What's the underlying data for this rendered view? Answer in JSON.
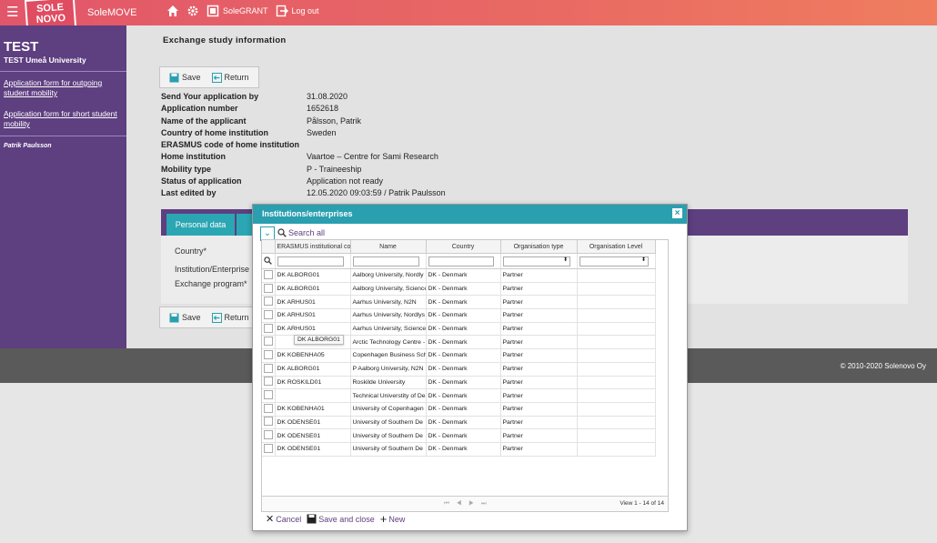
{
  "topbar": {
    "logo_top": "SOLE",
    "logo_bottom": "NOVO",
    "app_name": "SoleMOVE",
    "solegrant_label": "SoleGRANT",
    "logout_label": "Log out",
    "accent": "#e2566a"
  },
  "sidebar": {
    "title": "TEST",
    "org": "TEST Umeå University",
    "links": [
      "Application form for outgoing student mobility",
      "Application form for short student mobility"
    ],
    "user": "Patrik Paulsson"
  },
  "main": {
    "page_title": "Exchange study information",
    "save_label": "Save",
    "return_label": "Return",
    "info": [
      {
        "label": "Send Your application by",
        "value": "31.08.2020"
      },
      {
        "label": "Application number",
        "value": "1652618"
      },
      {
        "label": "Name of the applicant",
        "value": "Pålsson, Patrik"
      },
      {
        "label": "Country of home institution",
        "value": "Sweden"
      },
      {
        "label": "ERASMUS code of home institution",
        "value": ""
      },
      {
        "label": "Home institution",
        "value": "Vaartoe – Centre for Sami Research"
      },
      {
        "label": "Mobility type",
        "value": "P - Traineeship"
      },
      {
        "label": "Status of application",
        "value": "Application not ready"
      },
      {
        "label": "Last edited by",
        "value": "12.05.2020 09:03:59 / Patrik Paulsson"
      }
    ],
    "tab_personal": "Personal data",
    "form_labels": [
      "Country*",
      "Institution/Enterprise",
      "Exchange program*"
    ]
  },
  "footer": {
    "copyright": "© 2010-2020   Solenovo Oy"
  },
  "dialog": {
    "title": "Institutions/enterprises",
    "close": "×",
    "search_all": "Search all",
    "columns": [
      "ERASMUS institutional co",
      "Name",
      "Country",
      "Organisation type",
      "Organisation Level"
    ],
    "rows": [
      [
        "DK ALBORG01",
        "Aalborg University, Nordly",
        "DK - Denmark",
        "Partner",
        ""
      ],
      [
        "DK ALBORG01",
        "Aalborg University, Science",
        "DK - Denmark",
        "Partner",
        ""
      ],
      [
        "DK ARHUS01",
        "Aarhus University, N2N",
        "DK - Denmark",
        "Partner",
        ""
      ],
      [
        "DK ARHUS01",
        "Aarhus University, Nordlys",
        "DK - Denmark",
        "Partner",
        ""
      ],
      [
        "DK ARHUS01",
        "Aarhus University, Science",
        "DK - Denmark",
        "Partner",
        ""
      ],
      [
        "",
        "Arctic Technology Centre -",
        "DK - Denmark",
        "Partner",
        ""
      ],
      [
        "DK KOBENHA05",
        "Copenhagen Business Scho",
        "DK - Denmark",
        "Partner",
        ""
      ],
      [
        "DK ALBORG01",
        "P Aalborg University, N2N",
        "DK - Denmark",
        "Partner",
        ""
      ],
      [
        "DK ROSKILD01",
        "Roskilde University",
        "DK - Denmark",
        "Partner",
        ""
      ],
      [
        "",
        "Technical Universtity of De",
        "DK - Denmark",
        "Partner",
        ""
      ],
      [
        "DK KOBENHA01",
        "University of Copenhagen",
        "DK - Denmark",
        "Partner",
        ""
      ],
      [
        "DK ODENSE01",
        "University of Southern De",
        "DK - Denmark",
        "Partner",
        ""
      ],
      [
        "DK ODENSE01",
        "University of Southern De",
        "DK - Denmark",
        "Partner",
        ""
      ],
      [
        "DK ODENSE01",
        "University of Southern De",
        "DK - Denmark",
        "Partner",
        ""
      ]
    ],
    "tooltip": "DK ALBORG01",
    "pager_view": "View 1 - 14 of 14",
    "cancel_label": "Cancel",
    "save_close_label": "Save and close",
    "new_label": "New"
  }
}
